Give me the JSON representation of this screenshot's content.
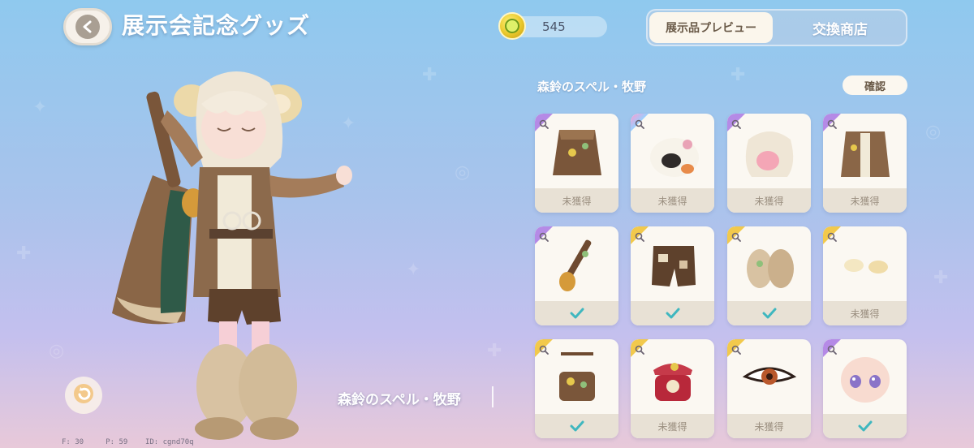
{
  "header": {
    "title": "展示会記念グッズ",
    "back_label": "back"
  },
  "currency": {
    "value": "545",
    "icon": "coin-icon"
  },
  "tabs": [
    {
      "label": "展示品プレビュー",
      "active": true
    },
    {
      "label": "交換商店",
      "active": false
    }
  ],
  "set": {
    "title": "森鈴のスペル・牧野",
    "confirm_label": "確認"
  },
  "character": {
    "outfit_name": "森鈴のスペル・牧野"
  },
  "debug": {
    "f_label": "F: 30",
    "p_label": "P: 59",
    "id_label": "ID: cgnd70q"
  },
  "items": [
    {
      "name": "tattered-skirt",
      "status": "未獲得",
      "obtained": false,
      "rarity": "purple"
    },
    {
      "name": "sheep-plush",
      "status": "未獲得",
      "obtained": false,
      "rarity": "rainbow"
    },
    {
      "name": "wavy-hair",
      "status": "未獲得",
      "obtained": false,
      "rarity": "purple"
    },
    {
      "name": "long-coat",
      "status": "未獲得",
      "obtained": false,
      "rarity": "purple"
    },
    {
      "name": "bell-staff",
      "status": "",
      "obtained": true,
      "rarity": "purple"
    },
    {
      "name": "patch-shorts",
      "status": "",
      "obtained": true,
      "rarity": "gold"
    },
    {
      "name": "fur-boots",
      "status": "",
      "obtained": true,
      "rarity": "gold"
    },
    {
      "name": "gloves",
      "status": "未獲得",
      "obtained": false,
      "rarity": "gold"
    },
    {
      "name": "satchel-bag",
      "status": "",
      "obtained": true,
      "rarity": "gold"
    },
    {
      "name": "red-telephone",
      "status": "未獲得",
      "obtained": false,
      "rarity": "gold"
    },
    {
      "name": "amber-eyes",
      "status": "未獲得",
      "obtained": false,
      "rarity": "gold"
    },
    {
      "name": "doll-face",
      "status": "",
      "obtained": true,
      "rarity": "purple"
    }
  ],
  "colors": {
    "check": "#3fb7bf",
    "rarity_purple": "#b58ae6",
    "rarity_gold": "#f2c94c",
    "card_bg": "#fbf8f2",
    "card_footer": "#e8e1d5"
  }
}
